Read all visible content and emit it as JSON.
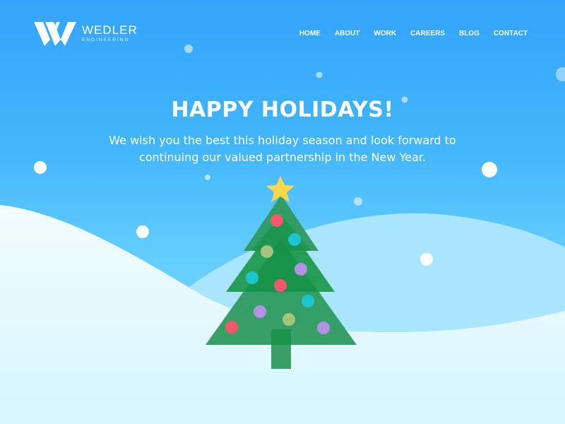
{
  "brand": {
    "name": "WEDLER",
    "tagline": "ENGINEERING",
    "logo_icon": "w-logo-icon"
  },
  "nav": {
    "items": [
      {
        "label": "HOME"
      },
      {
        "label": "ABOUT"
      },
      {
        "label": "WORK"
      },
      {
        "label": "CAREERS"
      },
      {
        "label": "BLOG"
      },
      {
        "label": "CONTACT"
      }
    ]
  },
  "hero": {
    "title": "HAPPY HOLIDAYS!",
    "message": "We wish you the best this holiday season and look forward to continuing our valued partnership in the New Year."
  },
  "illustration": {
    "tree_icon": "christmas-tree-icon",
    "star_icon": "star-icon",
    "snowflake_icon": "snowflake-icon"
  },
  "colors": {
    "sky_top": "#33a4fb",
    "sky_bottom": "#8fe0fe",
    "snow_hill": "#e6f9ff",
    "back_hill": "#a9e6fe",
    "tree_green": "#2e9a5e",
    "tree_dark": "#108f44",
    "star": "#ffd84a",
    "ornament_red": "#f5586e",
    "ornament_teal": "#1cc6cf",
    "ornament_purple": "#b392e6",
    "ornament_lime": "#a7c57a"
  }
}
